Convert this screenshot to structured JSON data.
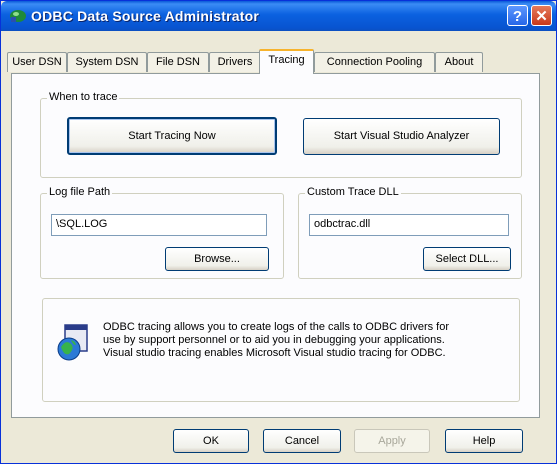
{
  "window": {
    "title": "ODBC Data Source Administrator"
  },
  "title_buttons": {
    "help": "?",
    "close": "✕"
  },
  "tabs": [
    {
      "label": "User DSN"
    },
    {
      "label": "System DSN"
    },
    {
      "label": "File DSN"
    },
    {
      "label": "Drivers"
    },
    {
      "label": "Tracing",
      "active": true
    },
    {
      "label": "Connection Pooling"
    },
    {
      "label": "About"
    }
  ],
  "when_to_trace": {
    "label": "When to trace",
    "start_button": "Start Tracing Now",
    "analyzer_button": "Start Visual Studio Analyzer"
  },
  "log_file": {
    "label": "Log file Path",
    "value": "\\SQL.LOG",
    "browse_button": "Browse..."
  },
  "custom_dll": {
    "label": "Custom Trace DLL",
    "value": "odbctrac.dll",
    "select_button": "Select DLL..."
  },
  "info": {
    "line1": "ODBC tracing allows you to create logs of the calls to ODBC drivers for",
    "line2": "use by support personnel or to aid you in debugging your applications.",
    "line3": "Visual studio tracing enables Microsoft Visual studio tracing for ODBC."
  },
  "footer": {
    "ok": "OK",
    "cancel": "Cancel",
    "apply": "Apply",
    "help": "Help"
  }
}
